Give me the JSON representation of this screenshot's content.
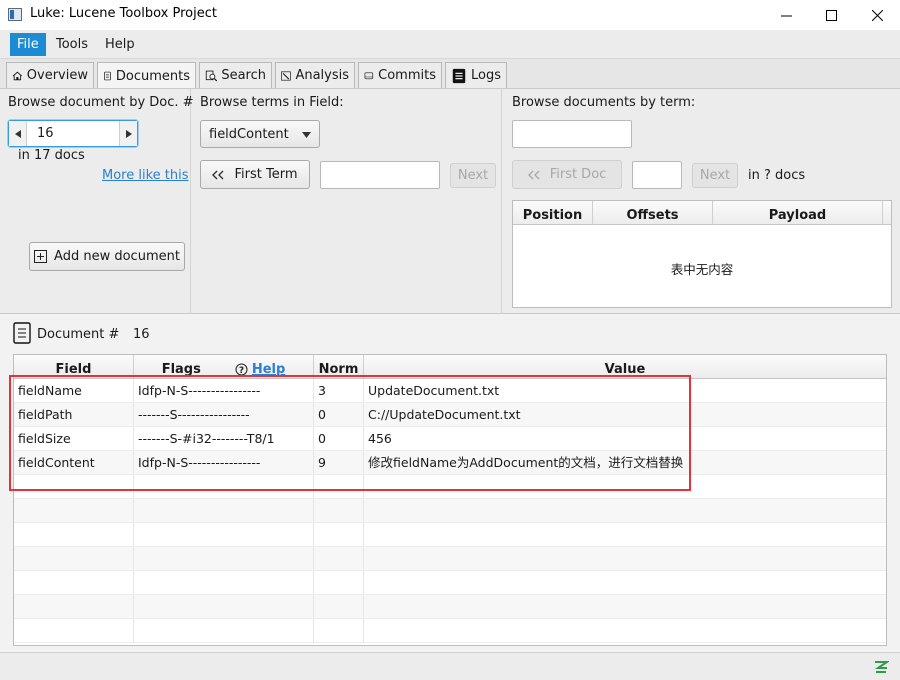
{
  "window": {
    "title": "Luke: Lucene Toolbox Project",
    "minimize": "—",
    "maximize": "☐",
    "close": "✕"
  },
  "menu": {
    "items": [
      "File",
      "Tools",
      "Help"
    ]
  },
  "tabs": [
    {
      "label": "Overview",
      "icon": "home-icon"
    },
    {
      "label": "Documents",
      "icon": "document-icon"
    },
    {
      "label": "Search",
      "icon": "search-icon"
    },
    {
      "label": "Analysis",
      "icon": "wand-icon"
    },
    {
      "label": "Commits",
      "icon": "disk-icon"
    },
    {
      "label": "Logs",
      "icon": "log-icon"
    }
  ],
  "browse_doc": {
    "title": "Browse document by Doc. #",
    "doc_value": "16",
    "count_text": "in 17 docs",
    "more_like_this": "More like this",
    "add_button": "Add new document"
  },
  "browse_terms": {
    "title": "Browse terms in Field:",
    "field_selected": "fieldContent",
    "first_term": "First Term",
    "term_value": "",
    "next": "Next"
  },
  "browse_by_term": {
    "title": "Browse documents by term:",
    "term_value": "",
    "first_doc": "First Doc",
    "doc_value": "",
    "next": "Next",
    "docs_text": "in ? docs",
    "columns": [
      "Position",
      "Offsets",
      "Payload"
    ],
    "empty_text": "表中无内容"
  },
  "document": {
    "label": "Document #",
    "number": "16",
    "columns": {
      "field": "Field",
      "flags": "Flags",
      "help": "Help",
      "norm": "Norm",
      "value": "Value"
    },
    "rows": [
      {
        "field": "fieldName",
        "flags": "Idfp-N-S----------------",
        "norm": "3",
        "value": "UpdateDocument.txt"
      },
      {
        "field": "fieldPath",
        "flags": "-------S----------------",
        "norm": "0",
        "value": "C://UpdateDocument.txt"
      },
      {
        "field": "fieldSize",
        "flags": "-------S-#i32--------T8/1",
        "norm": "0",
        "value": "456"
      },
      {
        "field": "fieldContent",
        "flags": "Idfp-N-S----------------",
        "norm": "9",
        "value": "修改fieldName为AddDocument的文档，进行文档替换"
      }
    ]
  },
  "colors": {
    "accent": "#1d8ad4",
    "link": "#2a7fd4",
    "highlight": "#e0333b"
  }
}
